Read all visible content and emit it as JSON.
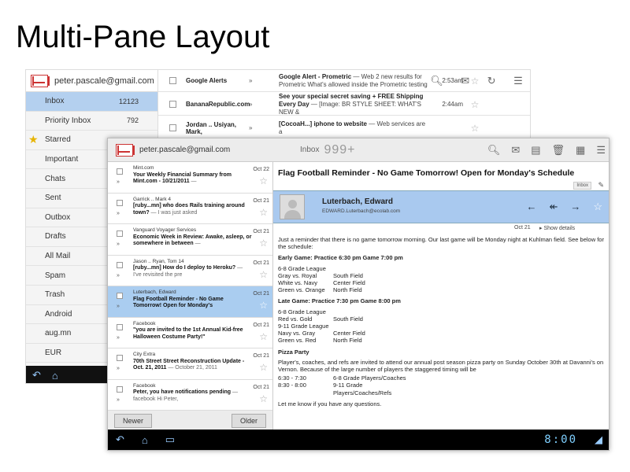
{
  "slide_title": "Multi-Pane Layout",
  "back": {
    "account": "peter.pascale@gmail.com",
    "folders": [
      {
        "label": "Inbox",
        "count": "12123",
        "selected": true
      },
      {
        "label": "Priority Inbox",
        "count": "792"
      },
      {
        "label": "Starred",
        "count": ""
      },
      {
        "label": "Important",
        "count": ""
      },
      {
        "label": "Chats",
        "count": ""
      },
      {
        "label": "Sent",
        "count": ""
      },
      {
        "label": "Outbox",
        "count": ""
      },
      {
        "label": "Drafts",
        "count": ""
      },
      {
        "label": "All Mail",
        "count": ""
      },
      {
        "label": "Spam",
        "count": ""
      },
      {
        "label": "Trash",
        "count": ""
      },
      {
        "label": "Android",
        "count": ""
      },
      {
        "label": "aug.mn",
        "count": ""
      },
      {
        "label": "EUR",
        "count": ""
      }
    ],
    "rows": [
      {
        "sender": "Google Alerts",
        "subject": "Google Alert - Prometric",
        "preview": " — Web 2 new results for Prometric What's allowed inside the Prometric testing",
        "time": "2:53am"
      },
      {
        "sender": "BananaRepublic.com",
        "subject": "See your special secret saving + FREE Shipping Every Day",
        "preview": " — [Image: BR STYLE SHEET: WHAT'S NEW &",
        "time": "2:44am"
      },
      {
        "sender": "Jordan .. Usiyan, Mark,",
        "subject": "[CocoaH...] iphone to website",
        "preview": " — Web services are a",
        "time": ""
      }
    ]
  },
  "front": {
    "account": "peter.pascale@gmail.com",
    "inbox_label": "Inbox",
    "inbox_count": "999+",
    "list": [
      {
        "sender": "Mint.com",
        "subject": "Your Weekly Financial Summary from Mint.com - 10/21/2011",
        "snippet": " —",
        "date": "Oct 22"
      },
      {
        "sender": "Garrick .. Mark  4",
        "subject": "[ruby...mn] who does Rails training around town?",
        "snippet": " — I was just asked",
        "date": "Oct 21"
      },
      {
        "sender": "Vanguard Voyager Services",
        "subject": "Economic Week in Review: Awake, asleep, or somewhere in between",
        "snippet": " —",
        "date": "Oct 21"
      },
      {
        "sender": "Jason .. Ryan, Tom  14",
        "subject": "[ruby...mn] How do I deploy to Heroku?",
        "snippet": " — I've revisited the pre",
        "date": "Oct 21"
      },
      {
        "sender": "Luterbach, Edward",
        "subject": "Flag Football Reminder - No Game Tomorrow! Open for Monday's",
        "snippet": "",
        "date": "Oct 21",
        "selected": true
      },
      {
        "sender": "Facebook",
        "subject": "\"you are invited to the 1st Annual Kid-free Halloween Costume Party!\"",
        "snippet": "",
        "date": "Oct 21"
      },
      {
        "sender": "City Extra",
        "subject": "70th Street Street Reconstruction Update - Oct. 21, 2011",
        "snippet": " — October 21, 2011",
        "date": "Oct 21"
      },
      {
        "sender": "Facebook",
        "subject": "Peter, you have notifications pending",
        "snippet": " — facebook Hi Peter,",
        "date": "Oct 21"
      }
    ],
    "newer": "Newer",
    "older": "Older",
    "clock": "8:00",
    "message": {
      "subject": "Flag Football Reminder - No Game Tomorrow! Open for Monday's Schedule",
      "label": "Inbox",
      "sender": "Luterbach, Edward",
      "email": "EDWARD.Luterbach@ecolab.com",
      "time": "Oct 21",
      "show_details": "Show details",
      "intro": "Just a reminder that there is no game tomorrow morning. Our last game will be Monday night at Kuhlman field. See below for the schedule:",
      "early_head": "Early Game: Practice 6:30 pm Game 7:00 pm",
      "early_league": "6-8 Grade League",
      "early_rows": [
        [
          "Gray vs. Royal",
          "South Field"
        ],
        [
          "White vs. Navy",
          "Center Field"
        ],
        [
          "Green vs. Orange",
          "North Field"
        ]
      ],
      "late_head": "Late Game: Practice 7:30 pm Game 8:00 pm",
      "late_league1": "6-8 Grade League",
      "late_rows1": [
        [
          "Red vs. Gold",
          "South Field"
        ]
      ],
      "late_league2": "9-11 Grade League",
      "late_rows2": [
        [
          "Navy vs. Gray",
          "Center Field"
        ],
        [
          "Green vs. Red",
          "North Field"
        ]
      ],
      "pizza_head": "Pizza Party",
      "pizza_text": "Player's, coaches, and refs are invited to attend our annual post season pizza party on Sunday October 30th at Davanni's on Vernon. Because of the large number of players the staggered timing will be",
      "pizza_rows": [
        [
          "6:30 - 7:30",
          "6-8 Grade Players/Coaches"
        ],
        [
          "8:30 - 8:00",
          "9-11 Grade Players/Coaches/Refs"
        ]
      ],
      "closing": "Let me know if you have any questions."
    }
  }
}
